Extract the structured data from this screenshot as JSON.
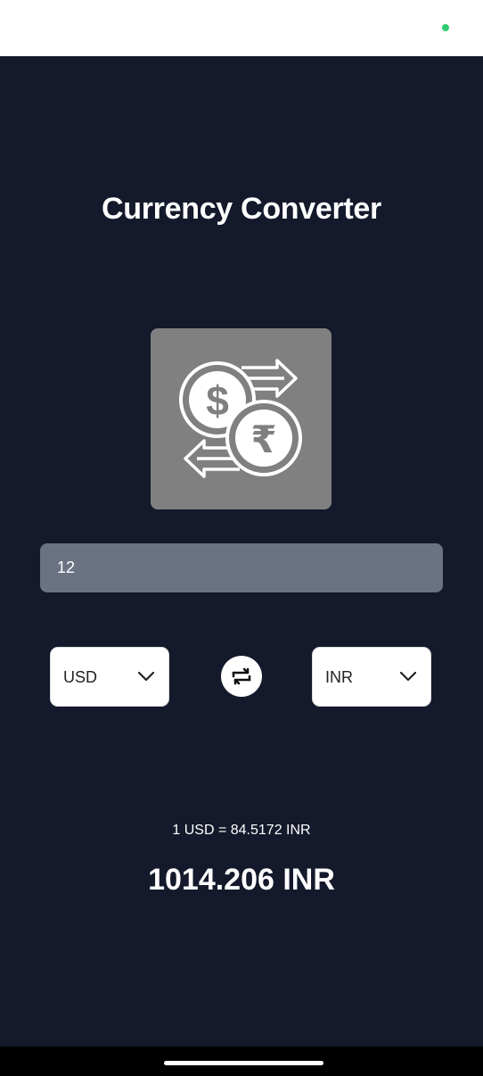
{
  "app": {
    "title": "Currency Converter",
    "logo_icon": "currency-exchange-icon"
  },
  "amount": {
    "value": "12",
    "placeholder": ""
  },
  "from_currency": {
    "selected": "USD",
    "icon": "chevron-down-icon"
  },
  "to_currency": {
    "selected": "INR",
    "icon": "chevron-down-icon"
  },
  "swap": {
    "icon": "swap-arrows-icon"
  },
  "rate_text": "1 USD = 84.5172 INR",
  "result_text": "1014.206 INR",
  "colors": {
    "background": "#141a2b",
    "input_bg": "#6b7282",
    "logo_bg": "#808080",
    "status_dot": "#2ecc71"
  }
}
